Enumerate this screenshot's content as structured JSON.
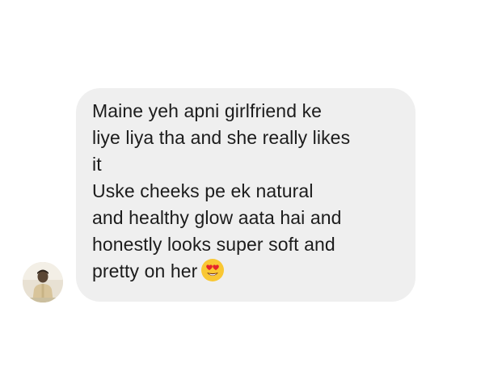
{
  "message": {
    "text": "Maine yeh apni girlfriend ke\nliye liya tha and she really likes\nit\nUske cheeks pe ek natural\nand healthy glow aata hai  and\nhonestly looks super soft and\npretty on her",
    "emoji": "heart-eyes-emoji"
  },
  "sender": {
    "avatar": "profile-photo"
  },
  "colors": {
    "bubble_background": "#efefef",
    "text": "#1c1c1c",
    "page_background": "#ffffff"
  }
}
